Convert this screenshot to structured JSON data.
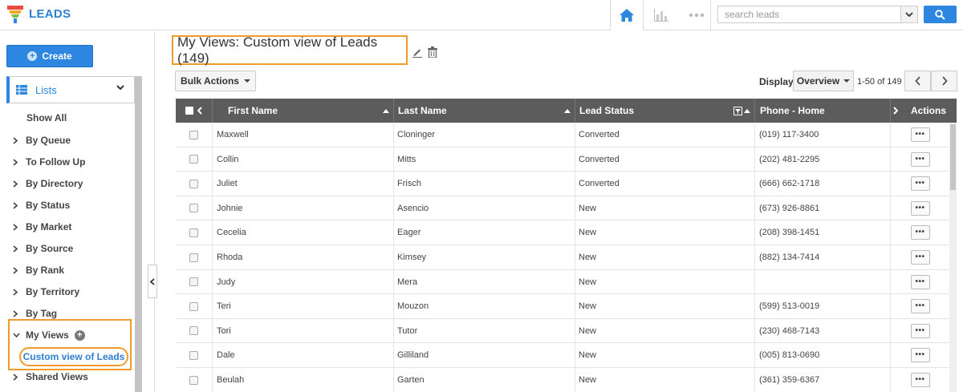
{
  "app": {
    "title": "LEADS"
  },
  "topbar": {
    "home_icon": "home-icon",
    "reports_icon": "bar-chart-icon",
    "more_icon": "more-dots-icon",
    "search_placeholder": "search leads",
    "search_icon": "search-icon",
    "colors": {
      "accent": "#2d86e0",
      "highlight": "#f19c2a"
    }
  },
  "sidebar": {
    "create_label": "Create",
    "lists_label": "Lists",
    "show_all": "Show All",
    "items": [
      {
        "label": "By Queue"
      },
      {
        "label": "To Follow Up"
      },
      {
        "label": "By Directory"
      },
      {
        "label": "By Status"
      },
      {
        "label": "By Market"
      },
      {
        "label": "By Source"
      },
      {
        "label": "By Rank"
      },
      {
        "label": "By Territory"
      },
      {
        "label": "By Tag"
      }
    ],
    "my_views_label": "My Views",
    "custom_view_label": "Custom view of Leads",
    "shared_views_label": "Shared Views"
  },
  "main": {
    "title": "My Views: Custom view of Leads (149)",
    "bulk_actions_label": "Bulk Actions",
    "display_label": "Display",
    "display_value": "Overview",
    "page_range": "1-50 of 149"
  },
  "table": {
    "columns": {
      "first_name": "First Name",
      "last_name": "Last Name",
      "lead_status": "Lead Status",
      "phone_home": "Phone - Home",
      "actions": "Actions"
    },
    "action_label": "•••",
    "rows": [
      {
        "first": "Maxwell",
        "last": "Cloninger",
        "status": "Converted",
        "phone": "(019) 117-3400"
      },
      {
        "first": "Collin",
        "last": "Mitts",
        "status": "Converted",
        "phone": "(202) 481-2295"
      },
      {
        "first": "Juliet",
        "last": "Frisch",
        "status": "Converted",
        "phone": "(666) 662-1718"
      },
      {
        "first": "Johnie",
        "last": "Asencio",
        "status": "New",
        "phone": "(673) 926-8861"
      },
      {
        "first": "Cecelia",
        "last": "Eager",
        "status": "New",
        "phone": "(208) 398-1451"
      },
      {
        "first": "Rhoda",
        "last": "Kimsey",
        "status": "New",
        "phone": "(882) 134-7414"
      },
      {
        "first": "Judy",
        "last": "Mera",
        "status": "New",
        "phone": ""
      },
      {
        "first": "Teri",
        "last": "Mouzon",
        "status": "New",
        "phone": "(599) 513-0019"
      },
      {
        "first": "Tori",
        "last": "Tutor",
        "status": "New",
        "phone": "(230) 468-7143"
      },
      {
        "first": "Dale",
        "last": "Gilliland",
        "status": "New",
        "phone": "(005) 813-0690"
      },
      {
        "first": "Beulah",
        "last": "Garten",
        "status": "New",
        "phone": "(361) 359-6367"
      }
    ]
  }
}
